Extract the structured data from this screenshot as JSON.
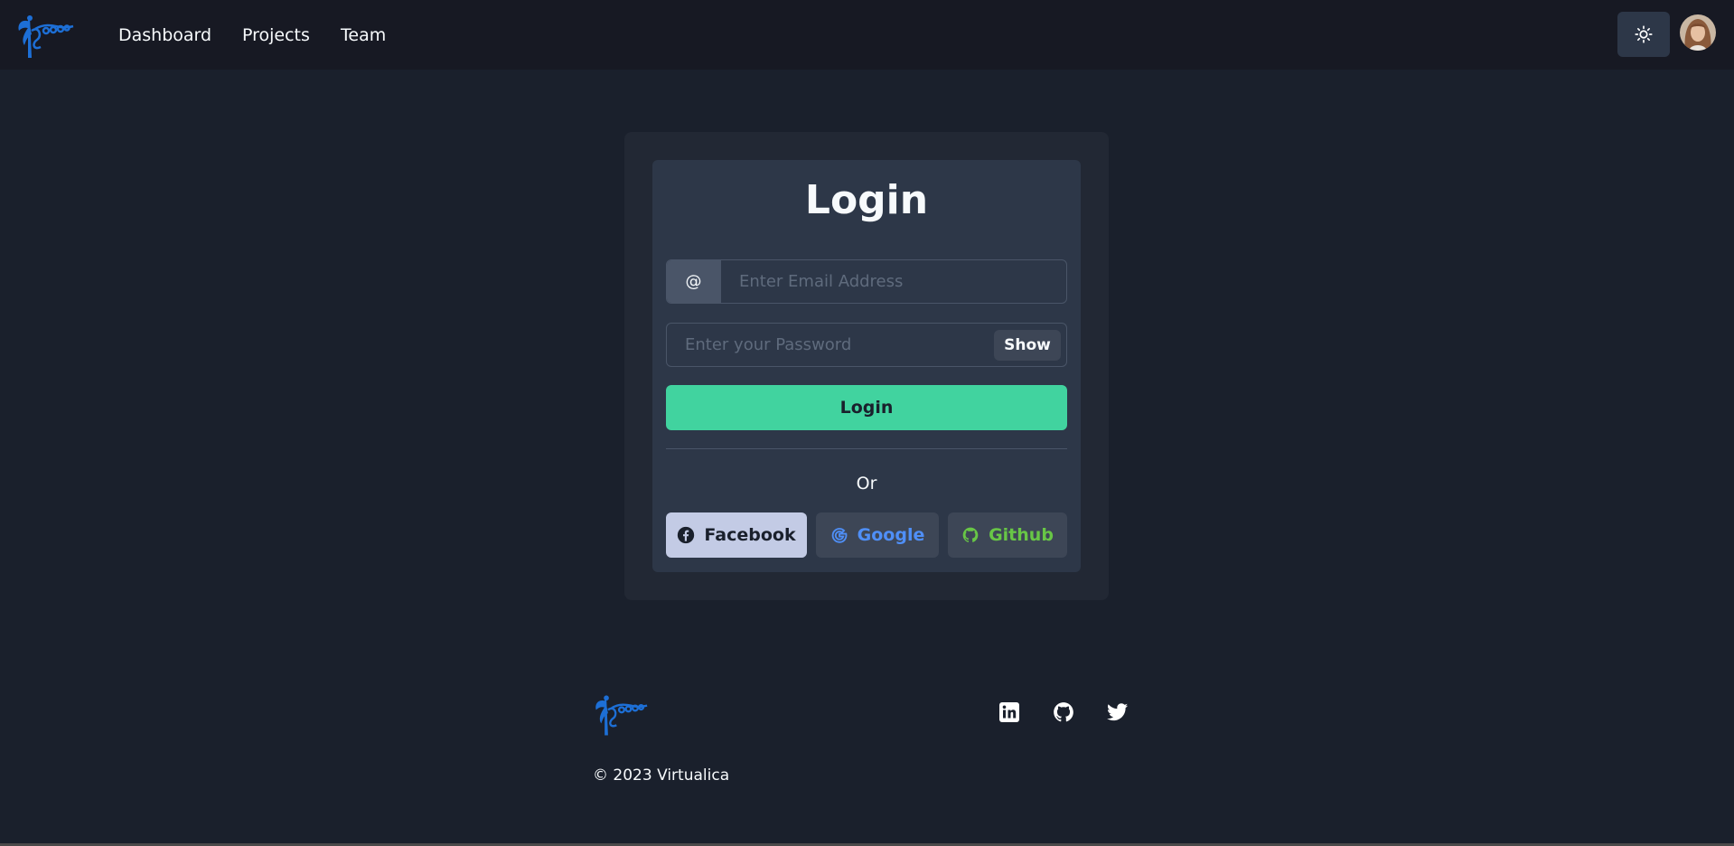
{
  "nav": {
    "links": [
      "Dashboard",
      "Projects",
      "Team"
    ]
  },
  "login": {
    "title": "Login",
    "email_addon": "@",
    "email_placeholder": "Enter Email Address",
    "password_placeholder": "Enter your Password",
    "show_label": "Show",
    "submit_label": "Login",
    "or_label": "Or",
    "social": [
      {
        "label": "Facebook",
        "icon": "facebook-icon"
      },
      {
        "label": "Google",
        "icon": "google-icon"
      },
      {
        "label": "Github",
        "icon": "github-icon"
      }
    ]
  },
  "footer": {
    "copyright": "© 2023 Virtualica",
    "social_icons": [
      "linkedin-icon",
      "github-icon",
      "twitter-icon"
    ]
  },
  "colors": {
    "background": "#1a202c",
    "navbar": "#171923",
    "card": "#2d3748",
    "accent_green": "#41d39f",
    "brand_blue": "#1d6fd6",
    "google_blue": "#4f8ff7",
    "github_green": "#68c646"
  }
}
